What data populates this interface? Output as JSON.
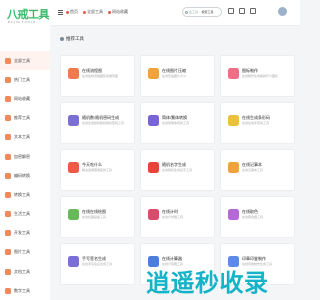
{
  "logo": {
    "text": "八戒工具",
    "subtitle": "BAJIE TOOLS"
  },
  "sidebar": {
    "items": [
      {
        "label": "全部工具"
      },
      {
        "label": "热门工具"
      },
      {
        "label": "网站收藏"
      },
      {
        "label": "推荐工具"
      },
      {
        "label": "文本工具"
      },
      {
        "label": "加密解密"
      },
      {
        "label": "编码转换"
      },
      {
        "label": "转换工具"
      },
      {
        "label": "生活工具"
      },
      {
        "label": "开发工具"
      },
      {
        "label": "图片工具"
      },
      {
        "label": "文档工具"
      },
      {
        "label": "数字工具"
      }
    ]
  },
  "topbar": {
    "nav": [
      {
        "label": "首页"
      },
      {
        "label": "全部工具"
      },
      {
        "label": "网站收藏"
      }
    ],
    "search_placeholder": "在工具...",
    "search_value": "搜索工具"
  },
  "section": {
    "title": "推荐工具"
  },
  "tools": [
    {
      "title": "在线流程图",
      "desc": "在线绘制流程图和思维导图",
      "color": "#f07a4e"
    },
    {
      "title": "在线图片压缩",
      "desc": "在线压缩图片大小",
      "color": "#f0a23c"
    },
    {
      "title": "图标制作",
      "desc": "在线制作生成各种尺寸图标",
      "color": "#ee6e86"
    },
    {
      "title": "随机数/随机密码生成",
      "desc": "在线生成随机数和随机密码工具",
      "color": "#7b6fd6"
    },
    {
      "title": "简体/繁体转换",
      "desc": "在线简繁体转换工具",
      "color": "#7a63d8"
    },
    {
      "title": "在线生成条形码",
      "desc": "在线生成条形码工具",
      "color": "#e9c13d"
    },
    {
      "title": "今天吃什么",
      "desc": "解决选择困难症的工具",
      "color": "#ee5a48"
    },
    {
      "title": "随机名字生成",
      "desc": "在线随机生成名字工具",
      "color": "#e8453a"
    },
    {
      "title": "在线记事本",
      "desc": "在线记事本工具",
      "color": "#f0a23c"
    },
    {
      "title": "在线在线绘图",
      "desc": "在线绘图画板工具",
      "color": "#67b95a"
    },
    {
      "title": "在线计时",
      "desc": "在线计时器工具",
      "color": "#d94c6b"
    },
    {
      "title": "在线取色",
      "desc": "在线取色器工具",
      "color": "#b568d6"
    },
    {
      "title": "手写签名生成",
      "desc": "在线手写签名生成工具",
      "color": "#7b6fd6"
    },
    {
      "title": "在线计算器",
      "desc": "在线计算器工具",
      "color": "#4a7fe0"
    },
    {
      "title": "印章印鉴制作",
      "desc": "在线印章制作生成工具",
      "color": "#5b8ae8"
    }
  ],
  "watermark": {
    "text": "逍遥秒收录"
  }
}
